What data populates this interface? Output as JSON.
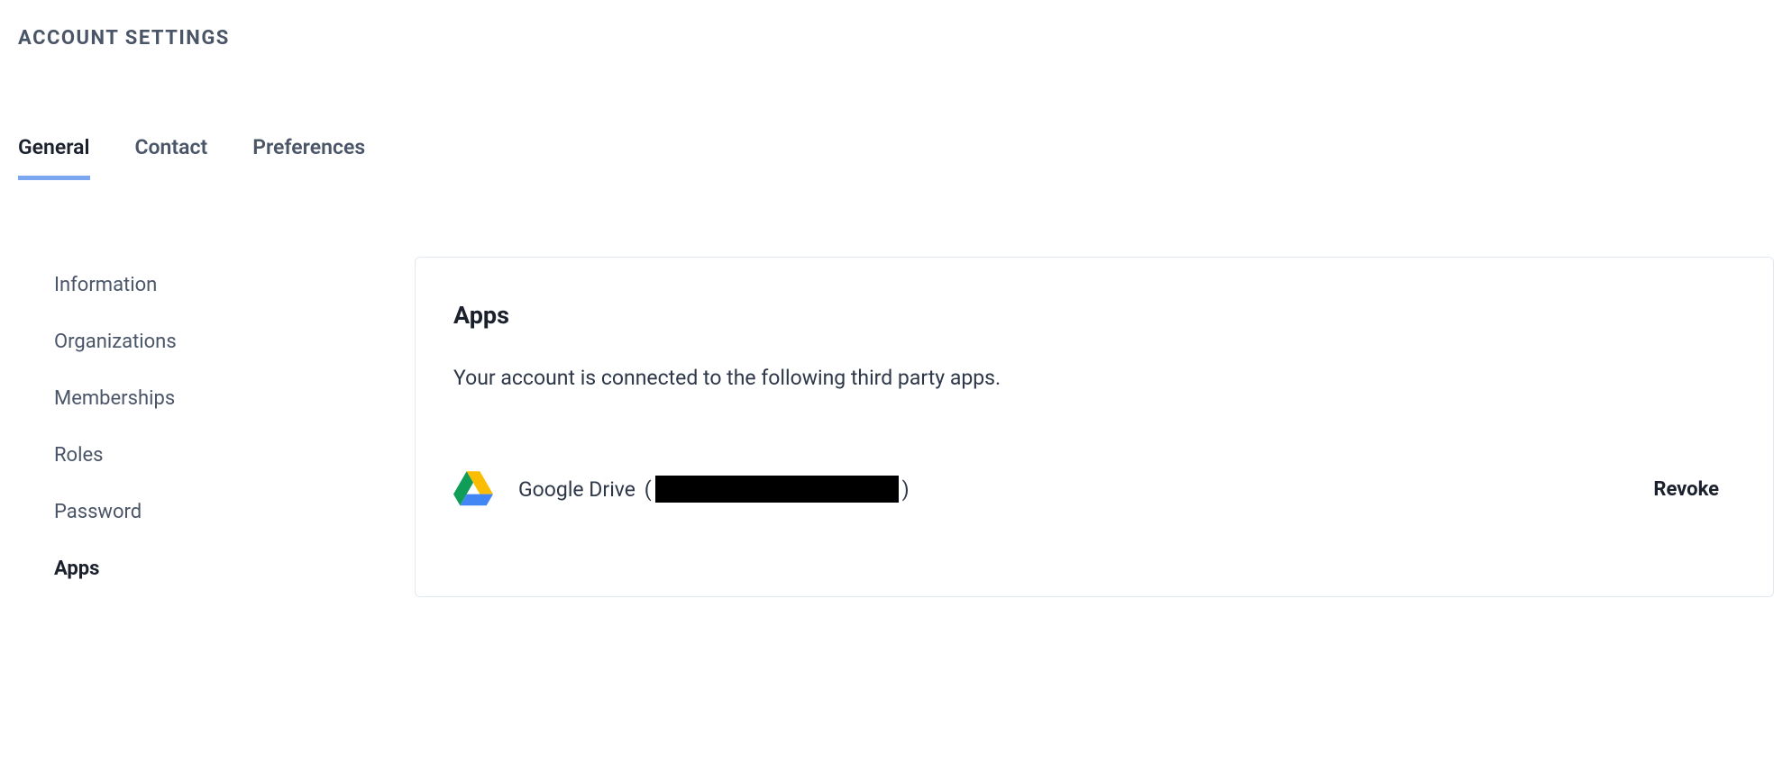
{
  "header": {
    "title": "ACCOUNT SETTINGS"
  },
  "tabs": [
    {
      "label": "General",
      "active": true
    },
    {
      "label": "Contact",
      "active": false
    },
    {
      "label": "Preferences",
      "active": false
    }
  ],
  "sidebar": {
    "items": [
      {
        "label": "Information",
        "active": false
      },
      {
        "label": "Organizations",
        "active": false
      },
      {
        "label": "Memberships",
        "active": false
      },
      {
        "label": "Roles",
        "active": false
      },
      {
        "label": "Password",
        "active": false
      },
      {
        "label": "Apps",
        "active": true
      }
    ]
  },
  "panel": {
    "title": "Apps",
    "description": "Your account is connected to the following third party apps.",
    "apps": [
      {
        "icon": "google-drive-icon",
        "name": "Google Drive",
        "account_redacted": true,
        "revoke_label": "Revoke"
      }
    ]
  }
}
